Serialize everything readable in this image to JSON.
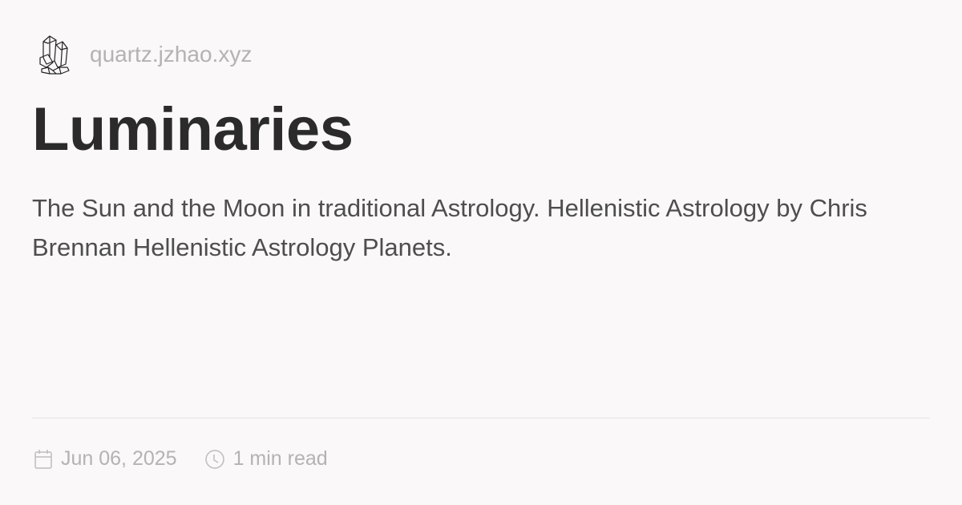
{
  "header": {
    "site_name": "quartz.jzhao.xyz",
    "logo_icon": "crystal-icon"
  },
  "article": {
    "title": "Luminaries",
    "description": "The Sun and the Moon in traditional Astrology. Hellenistic Astrology by Chris Brennan Hellenistic Astrology Planets."
  },
  "meta": {
    "date": "Jun 06, 2025",
    "read_time": "1 min read",
    "date_icon": "calendar-icon",
    "time_icon": "clock-icon"
  },
  "colors": {
    "background": "#faf8f8",
    "title": "#2b2b2b",
    "text": "#4e4e4e",
    "muted": "#b3b3b3"
  }
}
